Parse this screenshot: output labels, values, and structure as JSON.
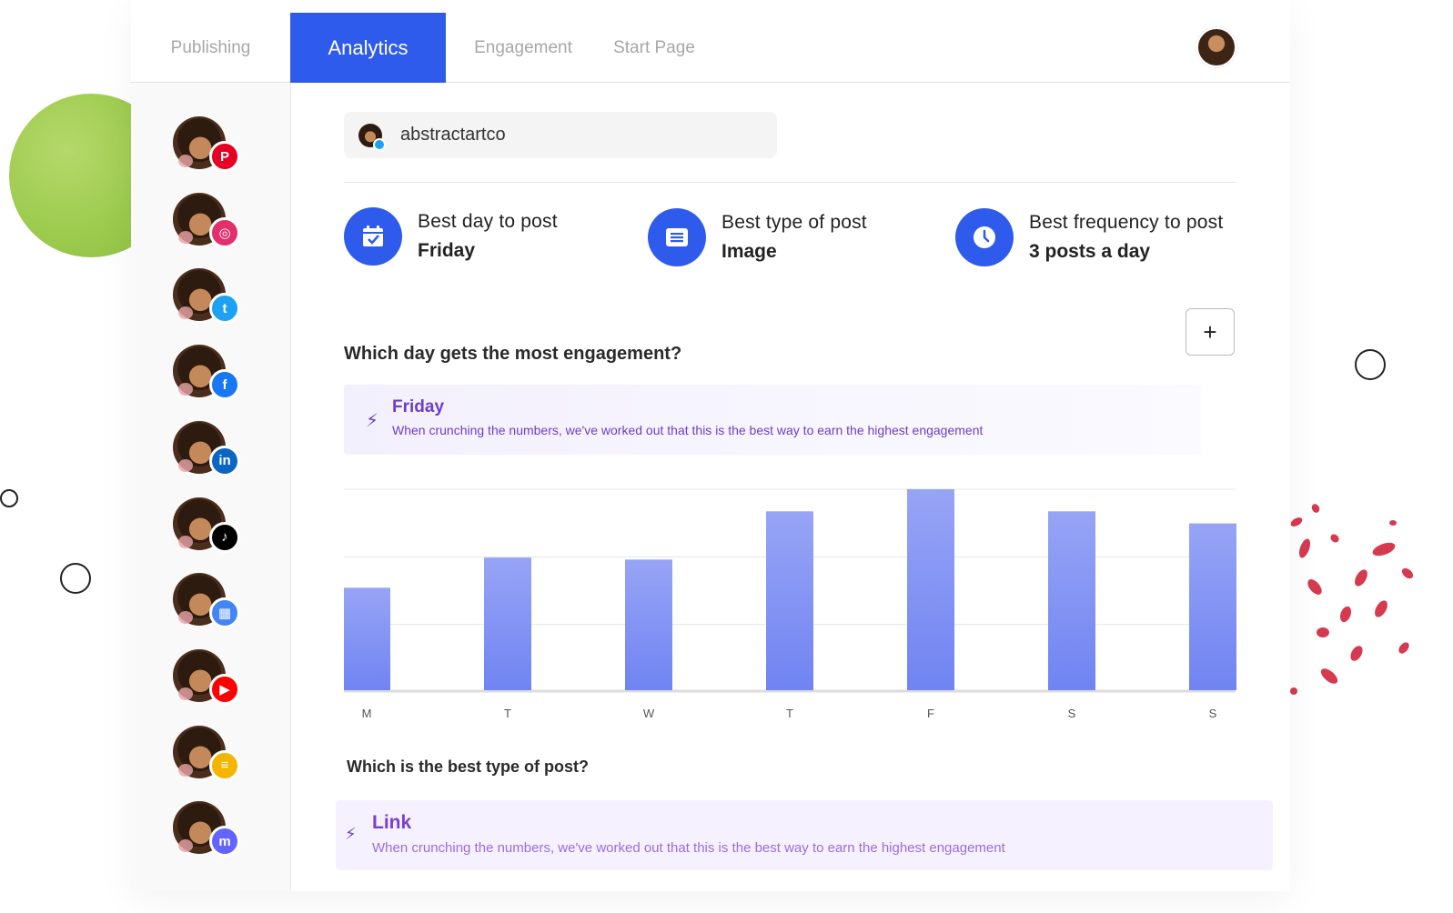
{
  "header": {
    "tabs": [
      {
        "label": "Publishing",
        "active": false
      },
      {
        "label": "Analytics",
        "active": true
      },
      {
        "label": "Engagement",
        "active": false
      },
      {
        "label": "Start Page",
        "active": false
      }
    ]
  },
  "sidebar": {
    "accounts": [
      {
        "network": "pinterest",
        "icon": "pinterest-icon",
        "color": "#e60023",
        "glyph": "P"
      },
      {
        "network": "instagram",
        "icon": "instagram-icon",
        "color": "#e1306c",
        "glyph": "◎"
      },
      {
        "network": "twitter",
        "icon": "twitter-icon",
        "color": "#1da1f2",
        "glyph": "t"
      },
      {
        "network": "facebook",
        "icon": "facebook-icon",
        "color": "#1877f2",
        "glyph": "f"
      },
      {
        "network": "linkedin",
        "icon": "linkedin-icon",
        "color": "#0a66c2",
        "glyph": "in"
      },
      {
        "network": "tiktok",
        "icon": "tiktok-icon",
        "color": "#000000",
        "glyph": "♪"
      },
      {
        "network": "google-business",
        "icon": "storefront-icon",
        "color": "#4285f4",
        "glyph": "▦"
      },
      {
        "network": "youtube",
        "icon": "youtube-icon",
        "color": "#ff0000",
        "glyph": "▶"
      },
      {
        "network": "start-page",
        "icon": "startpage-icon",
        "color": "#f4b400",
        "glyph": "≡"
      },
      {
        "network": "mastodon",
        "icon": "mastodon-icon",
        "color": "#6364ff",
        "glyph": "m"
      }
    ]
  },
  "account": {
    "name": "abstractartco"
  },
  "stats": [
    {
      "label": "Best day to post",
      "value": "Friday",
      "icon": "calendar-check-icon"
    },
    {
      "label": "Best type of post",
      "value": "Image",
      "icon": "post-icon"
    },
    {
      "label": "Best frequency to post",
      "value": "3 posts a day",
      "icon": "clock-icon"
    }
  ],
  "plus_label": "+",
  "engagement_section": {
    "question": "Which day gets the most engagement?",
    "insight_title": "Friday",
    "insight_desc": "When crunching the numbers, we've worked out that this is the best way to earn the highest engagement"
  },
  "post_type_section": {
    "question": "Which is the best type of post?",
    "insight_title": "Link",
    "insight_desc": "When crunching the numbers, we've worked out that this is the best way to earn the highest engagement"
  },
  "colors": {
    "accent": "#2f5bec",
    "bar_top": "#97a4f5",
    "bar_bottom": "#7084f2",
    "insight_text": "#6d3ec8"
  },
  "chart_data": {
    "type": "bar",
    "categories": [
      "M",
      "T",
      "W",
      "T",
      "F",
      "S",
      "S"
    ],
    "values": [
      51,
      66,
      65,
      89,
      100,
      89,
      83
    ],
    "ylim": [
      0,
      100
    ],
    "grid": true,
    "title": "",
    "xlabel": "",
    "ylabel": ""
  }
}
